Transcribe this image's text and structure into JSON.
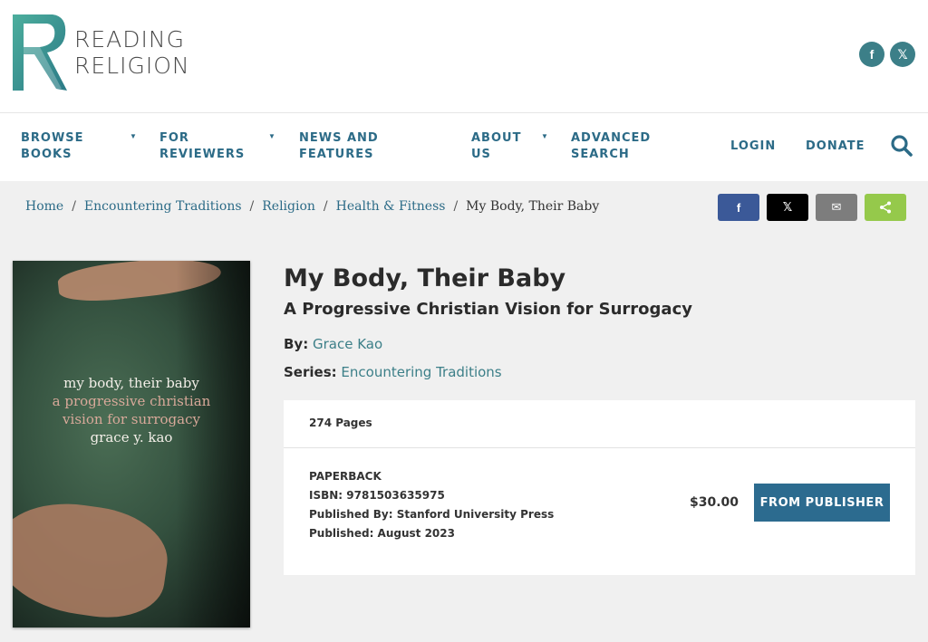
{
  "logo": {
    "line1": "READING",
    "line2": "RELIGION",
    "brand_color": "#3c9a93"
  },
  "social_top": [
    {
      "icon": "facebook-icon",
      "glyph": "f"
    },
    {
      "icon": "x-icon",
      "glyph": "𝕏"
    }
  ],
  "nav": {
    "items": [
      {
        "line1": "BROWSE",
        "line2": "BOOKS",
        "has_dropdown": true
      },
      {
        "line1": "FOR",
        "line2": "REVIEWERS",
        "has_dropdown": true
      },
      {
        "line1": "NEWS AND",
        "line2": "FEATURES",
        "has_dropdown": false
      },
      {
        "line1": "ABOUT",
        "line2": "US",
        "has_dropdown": true
      },
      {
        "line1": "ADVANCED",
        "line2": "SEARCH",
        "has_dropdown": false
      },
      {
        "line1": "LOGIN",
        "line2": "",
        "has_dropdown": false
      },
      {
        "line1": "DONATE",
        "line2": "",
        "has_dropdown": false
      }
    ],
    "search_icon": "search-icon",
    "color": "#2c6b87"
  },
  "breadcrumb": {
    "items": [
      "Home",
      "Encountering Traditions",
      "Religion",
      "Health & Fitness"
    ],
    "current": "My Body, Their Baby",
    "separator": "/"
  },
  "share": [
    {
      "icon": "facebook-icon",
      "glyph": "f",
      "color": "#3b5998"
    },
    {
      "icon": "x-icon",
      "glyph": "𝕏",
      "color": "#000000"
    },
    {
      "icon": "email-icon",
      "glyph": "✉",
      "color": "#7d7d7d"
    },
    {
      "icon": "share-icon",
      "glyph": "<",
      "color": "#95c94b"
    }
  ],
  "cover": {
    "line1": "my body, their baby",
    "line2": "a progressive christian",
    "line3": "vision for surrogacy",
    "line4": "grace y. kao"
  },
  "book": {
    "title": "My Body, Their Baby",
    "subtitle": "A Progressive Christian Vision for Surrogacy",
    "by_label": "By:",
    "author": "Grace Kao",
    "series_label": "Series:",
    "series": "Encountering Traditions"
  },
  "edition": {
    "pages": "274 Pages",
    "format": "PAPERBACK",
    "isbn": "ISBN: 9781503635975",
    "publisher": "Published By: Stanford University Press",
    "published": "Published: August 2023",
    "price": "$30.00",
    "button": "FROM PUBLISHER"
  }
}
